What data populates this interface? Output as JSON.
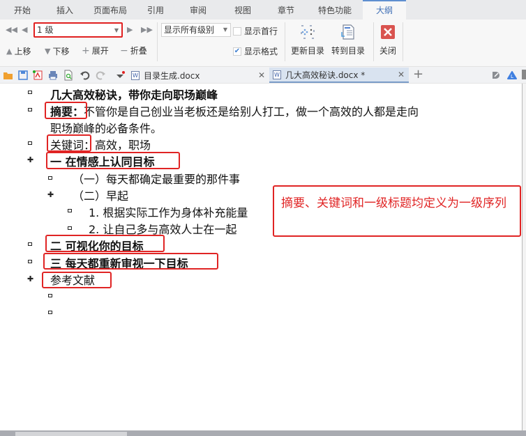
{
  "menu_tabs": [
    {
      "label": "开始"
    },
    {
      "label": "插入"
    },
    {
      "label": "页面布局"
    },
    {
      "label": "引用"
    },
    {
      "label": "审阅"
    },
    {
      "label": "视图"
    },
    {
      "label": "章节"
    },
    {
      "label": "特色功能"
    },
    {
      "label": "大纲",
      "active": true
    }
  ],
  "ribbon": {
    "level_select": "1 级",
    "show_level_select": "显示所有级别",
    "show_first_line": {
      "label": "显示首行",
      "checked": false
    },
    "show_format": {
      "label": "显示格式",
      "checked": true
    },
    "move_up": "上移",
    "move_down": "下移",
    "expand": "展开",
    "collapse": "折叠",
    "update_toc": "更新目录",
    "goto_toc": "转到目录",
    "close": "关闭"
  },
  "doc_tabs": [
    {
      "label": "目录生成.docx",
      "active": false
    },
    {
      "label": "几大高效秘诀.docx *",
      "active": true
    }
  ],
  "outline": [
    {
      "text": "几大高效秘诀，带你走向职场巅峰",
      "bold": true
    },
    {
      "head": "摘要：",
      "text": "不管你是自己创业当老板还是给别人打工，做一个高效的人都是走向",
      "cont": "职场巅峰的必备条件。"
    },
    {
      "head": "关键词",
      "text": "：高效，职场"
    },
    {
      "text": "一  在情感上认同目标",
      "bold": true
    },
    {
      "text": "（一）每天都确定最重要的那件事"
    },
    {
      "text": "（二）早起"
    },
    {
      "text": "1. 根据实际工作为身体补充能量"
    },
    {
      "text": "2. 让自己多与高效人士在一起"
    },
    {
      "text": "二  可视化你的目标",
      "bold": true
    },
    {
      "text": "三  每天都重新审视一下目标",
      "bold": true
    },
    {
      "text": "参考文献"
    }
  ],
  "annotation": "摘要、关键词和一级标题均定义为一级序列",
  "colors": {
    "accent": "#3f6fb6",
    "highlight_red": "#e02424"
  }
}
